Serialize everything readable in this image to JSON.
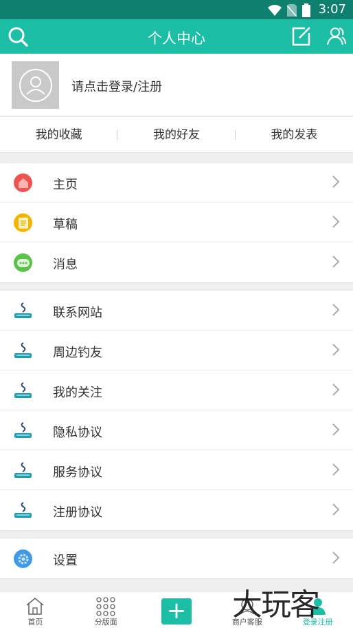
{
  "statusbar": {
    "time": "3:07"
  },
  "header": {
    "title": "个人中心"
  },
  "profile": {
    "login_prompt": "请点击登录/注册"
  },
  "tabs": [
    {
      "label": "我的收藏"
    },
    {
      "label": "我的好友"
    },
    {
      "label": "我的发表"
    }
  ],
  "group1": [
    {
      "label": "主页",
      "icon": "home-icon",
      "color": "#ef5350"
    },
    {
      "label": "草稿",
      "icon": "draft-icon",
      "color": "#f5b400"
    },
    {
      "label": "消息",
      "icon": "message-icon",
      "color": "#5cc24a"
    }
  ],
  "group2": [
    {
      "label": "联系网站",
      "icon": "site-logo-icon"
    },
    {
      "label": "周边钓友",
      "icon": "site-logo-icon"
    },
    {
      "label": "我的关注",
      "icon": "site-logo-icon"
    },
    {
      "label": "隐私协议",
      "icon": "site-logo-icon"
    },
    {
      "label": "服务协议",
      "icon": "site-logo-icon"
    },
    {
      "label": "注册协议",
      "icon": "site-logo-icon"
    }
  ],
  "group3": [
    {
      "label": "设置",
      "icon": "settings-icon",
      "color": "#3f9be8"
    }
  ],
  "bottombar": [
    {
      "label": "首页",
      "icon": "home-outline-icon"
    },
    {
      "label": "分版面",
      "icon": "grid-dots-icon"
    },
    {
      "label": "",
      "icon": "plus-icon"
    },
    {
      "label": "商户客服",
      "icon": "service-icon"
    },
    {
      "label": "登录注册",
      "icon": "user-login-icon",
      "active_color": "#1cbfa6"
    }
  ],
  "watermark": "大玩客",
  "colors": {
    "accent": "#1cbfa6",
    "statusbar": "#0f7f6f"
  }
}
